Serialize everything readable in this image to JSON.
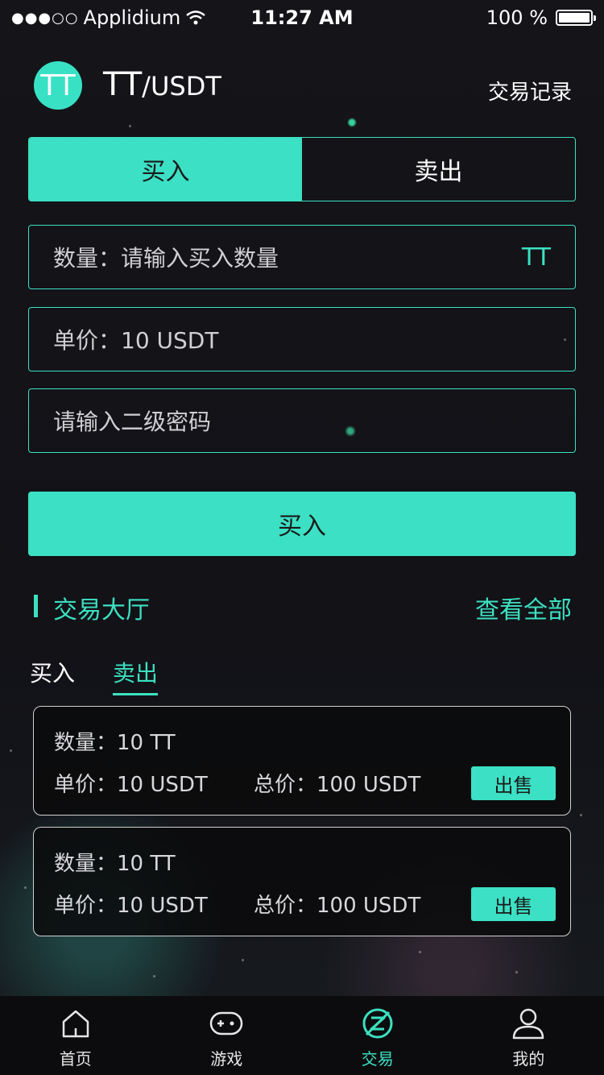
{
  "status_bar": {
    "signal": "●●●○○",
    "carrier": "Applidium",
    "time": "11:27 AM",
    "battery": "100 %"
  },
  "header": {
    "coin_logo": "TT",
    "pair_base": "TT",
    "pair_quote": "/USDT",
    "trade_record": "交易记录"
  },
  "toggle": {
    "buy": "买入",
    "sell": "卖出"
  },
  "form": {
    "quantity_label": "数量：",
    "quantity_placeholder": "请输入买入数量",
    "quantity_unit": "TT",
    "price_text": "单价：10 USDT",
    "password_placeholder": "请输入二级密码",
    "submit": "买入"
  },
  "hall": {
    "title": "交易大厅",
    "view_all": "查看全部",
    "tabs": {
      "buy": "买入",
      "sell": "卖出"
    },
    "orders": [
      {
        "quantity": "数量：10 TT",
        "price": "单价：10 USDT",
        "total": "总价：100 USDT",
        "action": "出售"
      },
      {
        "quantity": "数量：10 TT",
        "price": "单价：10 USDT",
        "total": "总价：100 USDT",
        "action": "出售"
      }
    ]
  },
  "tabbar": {
    "items": [
      {
        "label": "首页",
        "icon": "home-icon"
      },
      {
        "label": "游戏",
        "icon": "gamepad-icon"
      },
      {
        "label": "交易",
        "icon": "trade-icon"
      },
      {
        "label": "我的",
        "icon": "user-icon"
      }
    ]
  },
  "colors": {
    "accent": "#3ce0c4",
    "background": "#121217"
  }
}
